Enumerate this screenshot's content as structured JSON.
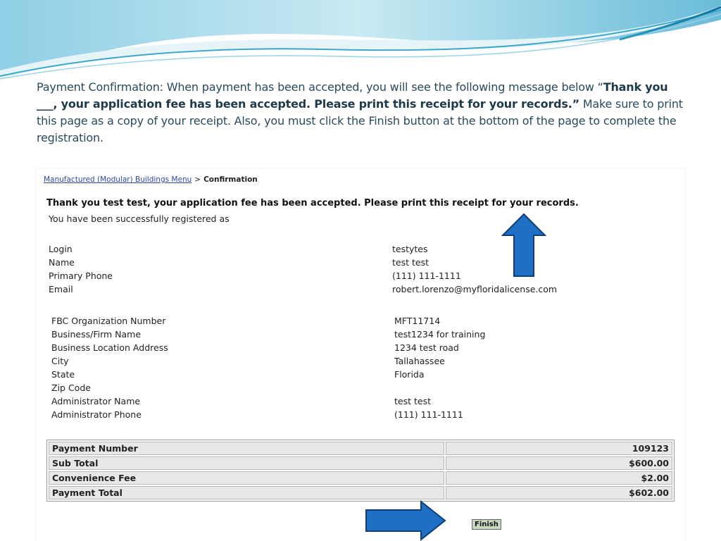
{
  "instructions": {
    "intro": "Payment Confirmation: When payment has been accepted, you will see the following message below “",
    "bold": "Thank you ___, your application fee has been accepted. Please print this receipt for your records.”",
    "outro": " Make sure to print this page as a copy of your receipt. Also, you must click the Finish button at the bottom of the page to complete the registration."
  },
  "breadcrumb": {
    "link": "Manufactured (Modular) Buildings Menu",
    "separator": ">",
    "current": "Confirmation"
  },
  "confirmation": {
    "thank_you": "Thank you test test, your application fee has been accepted. Please print this receipt for your records.",
    "registered": "You have been successfully registered as"
  },
  "user_info": [
    {
      "label": "Login",
      "value": "testytes"
    },
    {
      "label": "Name",
      "value": "test test"
    },
    {
      "label": "Primary Phone",
      "value": "(111) 111-1111"
    },
    {
      "label": "Email",
      "value": "robert.lorenzo@myfloridalicense.com"
    }
  ],
  "org_info": [
    {
      "label": "FBC Organization Number",
      "value": "MFT11714"
    },
    {
      "label": "Business/Firm Name",
      "value": "test1234 for training"
    },
    {
      "label": "Business Location Address",
      "value": "1234 test road"
    },
    {
      "label": "City",
      "value": "Tallahassee"
    },
    {
      "label": "State",
      "value": "Florida"
    },
    {
      "label": "Zip Code",
      "value": ""
    },
    {
      "label": "Administrator Name",
      "value": "test test"
    },
    {
      "label": "Administrator Phone",
      "value": "(111) 111-1111"
    }
  ],
  "payment": [
    {
      "label": "Payment Number",
      "value": "109123"
    },
    {
      "label": "Sub Total",
      "value": "$600.00"
    },
    {
      "label": "Convenience Fee",
      "value": "$2.00"
    },
    {
      "label": "Payment Total",
      "value": "$602.00"
    }
  ],
  "finish_label": "Finish",
  "colors": {
    "arrow_fill": "#1f6fc4",
    "arrow_stroke": "#0e3f7a",
    "wave_light": "#bfe6f0",
    "wave_dark": "#2a9cc0"
  }
}
